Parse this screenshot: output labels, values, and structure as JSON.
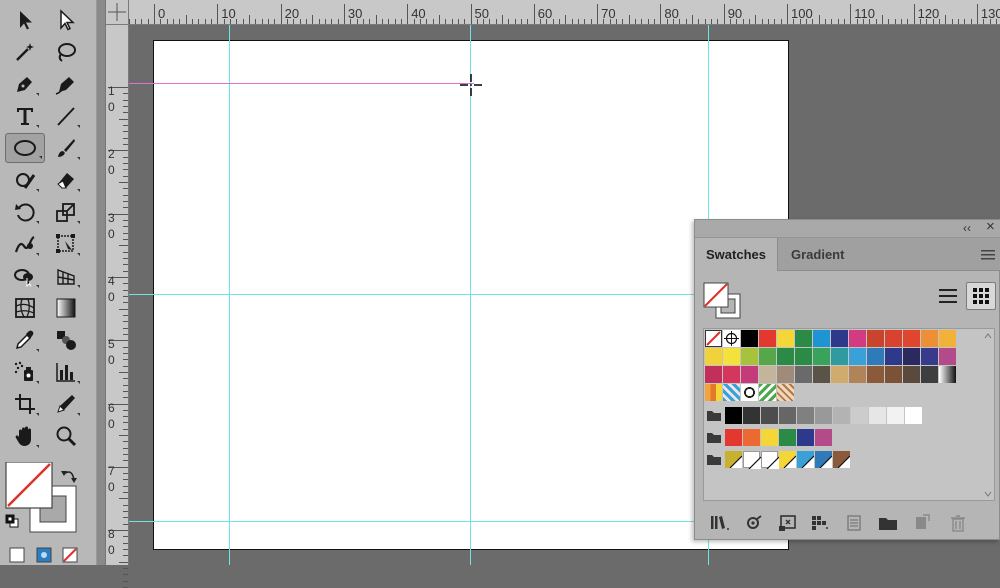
{
  "ruler": {
    "h_labels": [
      "0",
      "10",
      "20",
      "30",
      "40",
      "50",
      "60",
      "70",
      "80",
      "90",
      "100",
      "110",
      "120",
      "130"
    ],
    "v_labels": [
      [
        "1",
        "0"
      ],
      [
        "2",
        "0"
      ],
      [
        "3",
        "0"
      ],
      [
        "4",
        "0"
      ],
      [
        "5",
        "0"
      ],
      [
        "6",
        "0"
      ],
      [
        "7",
        "0"
      ],
      [
        "8",
        "0"
      ]
    ]
  },
  "tools": [
    "selection",
    "direct-selection",
    "magic-wand",
    "lasso",
    "pen",
    "curvature",
    "type",
    "line-segment",
    "ellipse",
    "paintbrush",
    "shaper",
    "eraser",
    "rotate",
    "scale",
    "warp",
    "free-transform",
    "shape-builder",
    "perspective-grid",
    "mesh",
    "gradient",
    "eyedropper",
    "blend",
    "symbol-sprayer",
    "column-graph",
    "artboard",
    "slice",
    "hand",
    "zoom"
  ],
  "active_tool": "ellipse",
  "swatches_panel": {
    "tabs": [
      {
        "label": "Swatches"
      },
      {
        "label": "Gradient"
      }
    ],
    "collapse_glyph": "‹‹",
    "close_glyph": "×",
    "rows": [
      [
        "none",
        "reg",
        "#000000",
        "#e2382f",
        "#f4d638",
        "#2a8a46",
        "#1f94d2",
        "#2d3a8c",
        "#d23a82",
        "#c9442c",
        "#d8432f",
        "#e0452e",
        "#ec8f36",
        "#f2b23a"
      ],
      [
        "#f2d23a",
        "#f4e13a",
        "#a9c23e",
        "#56a64a",
        "#2a8a46",
        "#2a8a46",
        "#3aa35a",
        "#2f9aa0",
        "#3aa0d8",
        "#2f7ab8",
        "#2d3a8c",
        "#2b2a5e",
        "#3a3a8c",
        "#b34a8a"
      ],
      [
        "#c1305a",
        "#d4365e",
        "#c43a7a",
        "#c3b49c",
        "#a08a7a",
        "#6a6a6a",
        "#5a5448",
        "#cfac6e",
        "#b08458",
        "#8a5a3a",
        "#7a5238",
        "#5a4a3e",
        "#3e3e3e",
        "grad"
      ],
      [
        "pat1",
        "pat2",
        "pat3",
        "pat4",
        "pat5"
      ]
    ],
    "group_rows": [
      [
        "#000000",
        "#333333",
        "#4d4d4d",
        "#666666",
        "#808080",
        "#999999",
        "#b3b3b3",
        "#cccccc",
        "#e6e6e6",
        "#f2f2f2",
        "#ffffff"
      ],
      [
        "#e2382f",
        "#ec6a32",
        "#f4d638",
        "#2a8a46",
        "#2d3a8c",
        "#b34a8a"
      ],
      [
        "#c8b030",
        "white",
        "white",
        "#f4d638",
        "#3aa0d8",
        "#2f7ab8",
        "#8a5a3a"
      ]
    ]
  },
  "colors": {
    "guide": "#6fe3ea",
    "smart_guide": "#e070d8",
    "fill_none_slash": "#e0302a"
  }
}
